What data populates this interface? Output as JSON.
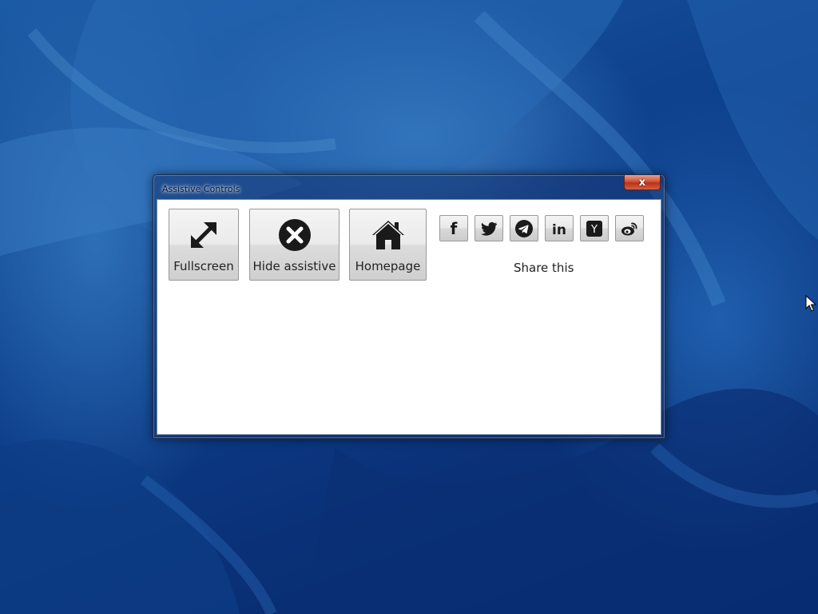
{
  "window": {
    "title": "Assistive Controls",
    "close_label": "x"
  },
  "controls": [
    {
      "label": "Fullscreen",
      "icon": "fullscreen-arrows-icon"
    },
    {
      "label": "Hide assistive",
      "icon": "close-circle-icon"
    },
    {
      "label": "Homepage",
      "icon": "home-icon"
    }
  ],
  "share": {
    "label": "Share this",
    "buttons": [
      {
        "icon": "facebook-icon",
        "glyph": "f"
      },
      {
        "icon": "twitter-icon"
      },
      {
        "icon": "telegram-icon"
      },
      {
        "icon": "linkedin-icon",
        "glyph": "in"
      },
      {
        "icon": "ycombinator-icon",
        "glyph": "Y"
      },
      {
        "icon": "weibo-icon"
      }
    ]
  }
}
